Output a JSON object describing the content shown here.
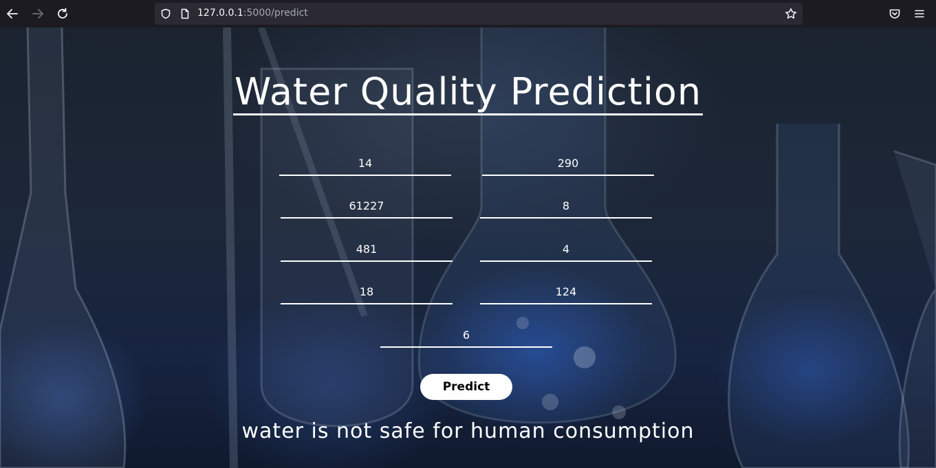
{
  "browser": {
    "url_host": "127.0.0.1",
    "url_rest": ":5000/predict"
  },
  "page": {
    "title": "Water Quality Prediction",
    "fields": [
      "14",
      "290",
      "61227",
      "8",
      "481",
      "4",
      "18",
      "124",
      "6"
    ],
    "predict_label": "Predict",
    "result": "water is not safe for human consumption"
  },
  "colors": {
    "accent": "#ffffff",
    "toolbar": "#1c1b22",
    "urlbar": "#2b2a33"
  }
}
